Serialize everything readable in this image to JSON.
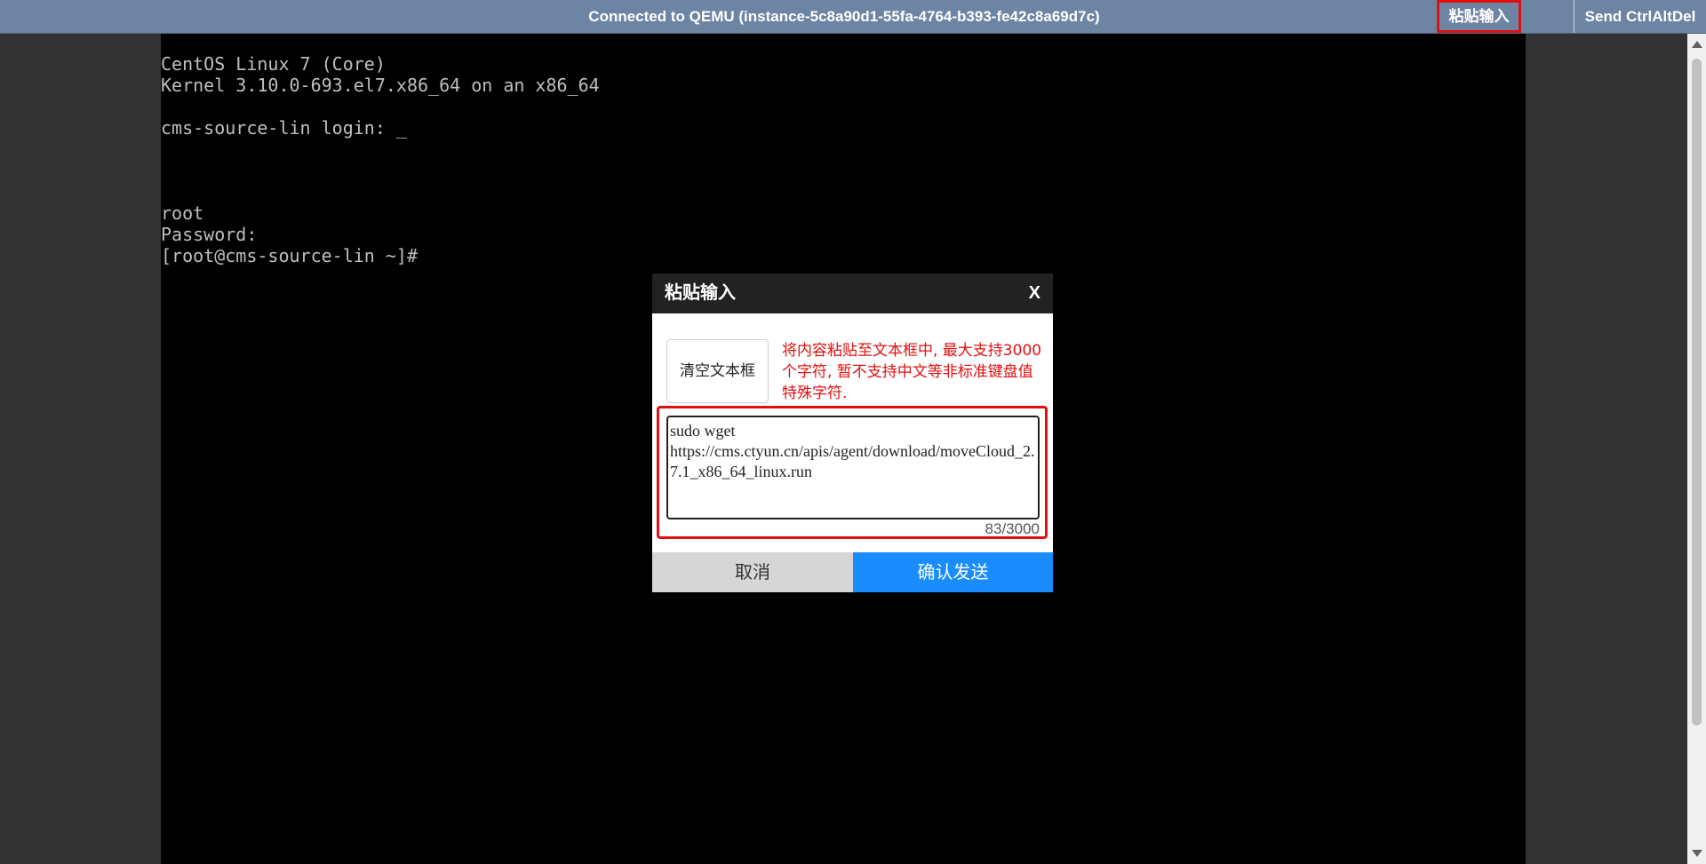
{
  "topbar": {
    "title": "Connected to QEMU (instance-5c8a90d1-55fa-4764-b393-fe42c8a69d7c)",
    "paste_button": "粘贴输入",
    "ctrl_alt_del_button": "Send CtrlAltDel"
  },
  "terminal": {
    "lines": [
      "CentOS Linux 7 (Core)",
      "Kernel 3.10.0-693.el7.x86_64 on an x86_64",
      "",
      "cms-source-lin login: _",
      "",
      "",
      "",
      "root",
      "Password:",
      "[root@cms-source-lin ~]#"
    ]
  },
  "dialog": {
    "title": "粘贴输入",
    "close": "X",
    "clear_button": "清空文本框",
    "hint": "将内容粘贴至文本框中, 最大支持3000个字符, 暂不支持中文等非标准键盘值特殊字符.",
    "textarea_value": "sudo wget https://cms.ctyun.cn/apis/agent/download/moveCloud_2.7.1_x86_64_linux.run",
    "counter": "83/3000",
    "cancel_button": "取消",
    "confirm_button": "确认发送"
  },
  "colors": {
    "topbar": "#6e84a3",
    "highlight": "#e01010",
    "confirm": "#1a8cff",
    "terminal_bg": "#000000"
  }
}
